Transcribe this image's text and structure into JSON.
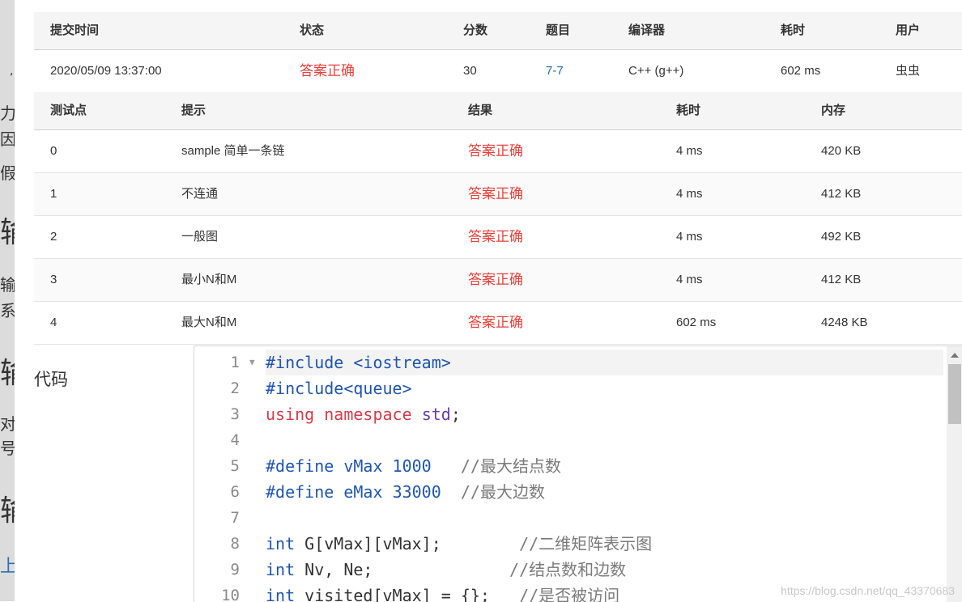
{
  "submission_table": {
    "headers": [
      "提交时间",
      "状态",
      "分数",
      "题目",
      "编译器",
      "耗时",
      "用户"
    ],
    "row": {
      "time": "2020/05/09 13:37:00",
      "status": "答案正确",
      "score": "30",
      "problem": "7-7",
      "compiler": "C++ (g++)",
      "elapsed": "602 ms",
      "user": "虫虫"
    }
  },
  "tests_table": {
    "headers": [
      "测试点",
      "提示",
      "结果",
      "耗时",
      "内存"
    ],
    "rows": [
      {
        "id": "0",
        "hint": "sample 简单一条链",
        "result": "答案正确",
        "time": "4 ms",
        "memory": "420 KB"
      },
      {
        "id": "1",
        "hint": "不连通",
        "result": "答案正确",
        "time": "4 ms",
        "memory": "412 KB"
      },
      {
        "id": "2",
        "hint": "一般图",
        "result": "答案正确",
        "time": "4 ms",
        "memory": "492 KB"
      },
      {
        "id": "3",
        "hint": "最小N和M",
        "result": "答案正确",
        "time": "4 ms",
        "memory": "412 KB"
      },
      {
        "id": "4",
        "hint": "最大N和M",
        "result": "答案正确",
        "time": "602 ms",
        "memory": "4248 KB"
      }
    ]
  },
  "code_section": {
    "label": "代码",
    "line_numbers": [
      "1",
      "2",
      "3",
      "4",
      "5",
      "6",
      "7",
      "8",
      "9",
      "10"
    ],
    "lines": [
      "#include <iostream>",
      "#include<queue>",
      "using namespace std;",
      "",
      "#define vMax 1000   //最大结点数",
      "#define eMax 33000  //最大边数",
      "",
      "int G[vMax][vMax];        //二维矩阵表示图",
      "int Nv, Ne;              //结点数和边数",
      "int visited[vMax] = {};   //是否被访问"
    ]
  },
  "background_page": {
    "fragments": [
      "力",
      "因",
      "假",
      "输",
      "输",
      "系",
      "输",
      "对",
      "号",
      "输",
      "上"
    ]
  },
  "watermark": "https://blog.csdn.net/qq_43370683",
  "colors": {
    "status_accepted": "#e8403a",
    "problem_link": "#1f6aa5",
    "keyword_blue": "#1f55b0",
    "keyword_red": "#d83a4a",
    "keyword_purple": "#6a3ab2",
    "comment": "#7a7a7a"
  },
  "icons": {
    "fold_marker": "fold-arrow-icon",
    "scroll_up": "scroll-up-arrow-icon"
  }
}
